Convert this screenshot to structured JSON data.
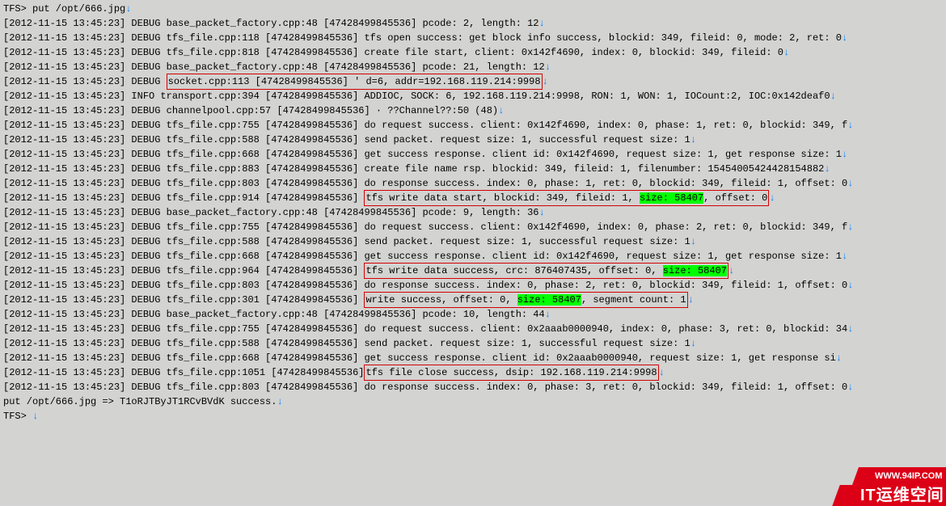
{
  "prompt1": "TFS> put /opt/666.jpg",
  "lines": [
    {
      "pre": "[2012-11-15 13:45:23] DEBUG base_packet_factory.cpp:48 [47428499845536] pcode: 2, length: 12"
    },
    {
      "pre": "[2012-11-15 13:45:23] DEBUG tfs_file.cpp:118 [47428499845536] tfs open success: get block info success, blockid: 349, fileid: 0, mode: 2, ret: 0"
    },
    {
      "pre": "[2012-11-15 13:45:23] DEBUG tfs_file.cpp:818 [47428499845536] create file start, client: 0x142f4690, index: 0, blockid: 349, fileid: 0"
    },
    {
      "pre": "[2012-11-15 13:45:23] DEBUG base_packet_factory.cpp:48 [47428499845536] pcode: 21, length: 12"
    },
    {
      "pre": "[2012-11-15 13:45:23] DEBUG ",
      "box": [
        {
          "t": "socket.cpp:113 [47428499845536] ' d=6, addr=192.168.119.214:9998"
        }
      ]
    },
    {
      "pre": "[2012-11-15 13:45:23] INFO  transport.cpp:394 [47428499845536] ADDIOC, SOCK: 6, 192.168.119.214:9998, RON: 1, WON: 1, IOCount:2, IOC:0x142deaf0"
    },
    {
      "pre": "[2012-11-15 13:45:23] DEBUG channelpool.cpp:57 [47428499845536]  · ??Channel??:50 (48)"
    },
    {
      "pre": "[2012-11-15 13:45:23] DEBUG tfs_file.cpp:755 [47428499845536] do request success. client: 0x142f4690, index: 0, phase: 1, ret: 0, blockid: 349, f"
    },
    {
      "pre": "[2012-11-15 13:45:23] DEBUG tfs_file.cpp:588 [47428499845536] send packet. request size: 1, successful request size: 1"
    },
    {
      "pre": "[2012-11-15 13:45:23] DEBUG tfs_file.cpp:668 [47428499845536] get success response. client id: 0x142f4690, request size: 1, get response size: 1"
    },
    {
      "pre": "[2012-11-15 13:45:23] DEBUG tfs_file.cpp:883 [47428499845536] create file name rsp. blockid: 349, fileid: 1, filenumber: 15454005424428154882"
    },
    {
      "pre": "[2012-11-15 13:45:23] DEBUG tfs_file.cpp:803 [47428499845536] do response success. index: 0, phase: 1, ret: 0, blockid: 349, fileid: 1, offset: 0"
    },
    {
      "pre": "[2012-11-15 13:45:23] DEBUG tfs_file.cpp:914 [47428499845536] ",
      "box": [
        {
          "t": "tfs write data start, blockid: 349, fileid: 1, "
        },
        {
          "t": "size: 58407",
          "hl": true
        },
        {
          "t": ", offset: 0"
        }
      ]
    },
    {
      "pre": "[2012-11-15 13:45:23] DEBUG base_packet_factory.cpp:48 [47428499845536] pcode: 9, length: 36"
    },
    {
      "pre": "[2012-11-15 13:45:23] DEBUG tfs_file.cpp:755 [47428499845536] do request success. client: 0x142f4690, index: 0, phase: 2, ret: 0, blockid: 349, f"
    },
    {
      "pre": "[2012-11-15 13:45:23] DEBUG tfs_file.cpp:588 [47428499845536] send packet. request size: 1, successful request size: 1"
    },
    {
      "pre": "[2012-11-15 13:45:23] DEBUG tfs_file.cpp:668 [47428499845536] get success response. client id: 0x142f4690, request size: 1, get response size: 1"
    },
    {
      "pre": "[2012-11-15 13:45:23] DEBUG tfs_file.cpp:964 [47428499845536] ",
      "box": [
        {
          "t": "tfs write data success, crc: 876407435, offset: 0, "
        },
        {
          "t": "size: 58407",
          "hl": true
        }
      ]
    },
    {
      "pre": "[2012-11-15 13:45:23] DEBUG tfs_file.cpp:803 [47428499845536] do response success. index: 0, phase: 2, ret: 0, blockid: 349, fileid: 1, offset: 0"
    },
    {
      "pre": "[2012-11-15 13:45:23] DEBUG tfs_file.cpp:301 [47428499845536] ",
      "box": [
        {
          "t": "write success, offset: 0, "
        },
        {
          "t": "size: 58407",
          "hl": true
        },
        {
          "t": ", segment count: 1"
        }
      ]
    },
    {
      "pre": "[2012-11-15 13:45:23] DEBUG base_packet_factory.cpp:48 [47428499845536] pcode: 10, length: 44"
    },
    {
      "pre": "[2012-11-15 13:45:23] DEBUG tfs_file.cpp:755 [47428499845536] do request success. client: 0x2aaab0000940, index: 0, phase: 3, ret: 0, blockid: 34"
    },
    {
      "pre": "[2012-11-15 13:45:23] DEBUG tfs_file.cpp:588 [47428499845536] send packet. request size: 1, successful request size: 1"
    },
    {
      "pre": "[2012-11-15 13:45:23] DEBUG tfs_file.cpp:668 [47428499845536] get success response. client id: 0x2aaab0000940, request size: 1, get response si"
    },
    {
      "pre": "[2012-11-15 13:45:23] DEBUG tfs_file.cpp:1051 [47428499845536]",
      "box": [
        {
          "t": " tfs file close success, dsip: 192.168.119.214:9998"
        }
      ]
    },
    {
      "pre": "[2012-11-15 13:45:23] DEBUG tfs_file.cpp:803 [47428499845536] do response success. index: 0, phase: 3, ret: 0, blockid: 349, fileid: 1, offset: 0"
    }
  ],
  "result": "put /opt/666.jpg => T1oRJTByJT1RCvBVdK success.",
  "prompt2": "TFS> ",
  "arrow": "↓",
  "watermark": {
    "url": "WWW.94IP.COM",
    "brand": "IT运维空间"
  }
}
